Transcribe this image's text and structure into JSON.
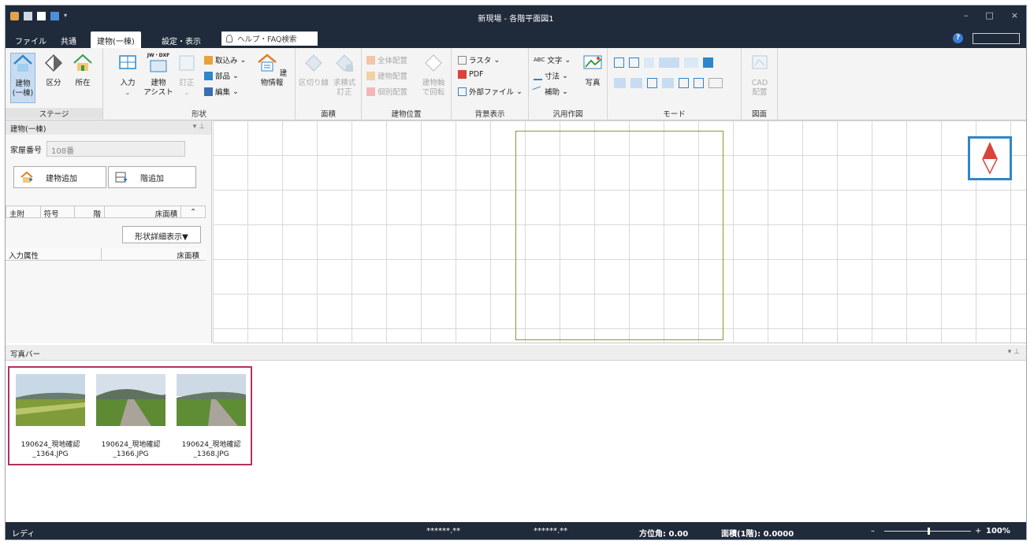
{
  "window": {
    "title": "新現場 - 各階平面図1",
    "min": "–",
    "max": "□",
    "close": "×"
  },
  "tabs": [
    {
      "label": "ファイル"
    },
    {
      "label": "共通"
    },
    {
      "label": "建物(一棟)"
    },
    {
      "label": "設定・表示"
    }
  ],
  "help": {
    "placeholder": "ヘルプ・FAQ検索",
    "help_icon": "?"
  },
  "ribbon": {
    "stage": {
      "label": "ステージ",
      "b1": "建物\n(一棟)",
      "b2": "区分",
      "b3": "所在"
    },
    "shape": {
      "label": "形状",
      "input": "入力",
      "assist": "建物\nアシスト",
      "fix": "訂正",
      "import": "取込み",
      "parts": "部品",
      "edit": "編集",
      "info": "建物情報",
      "jw": "JW・DXF"
    },
    "area": {
      "label": "面積",
      "divide": "区切り線",
      "calc": "求積式\n訂正"
    },
    "pos": {
      "label": "建物位置",
      "all": "全体配置",
      "place": "建物配置",
      "each": "個別配置",
      "rotate": "建物軸\nで回転"
    },
    "bg": {
      "label": "背景表示",
      "raster": "ラスタ",
      "pdf": "PDF",
      "external": "外部ファイル"
    },
    "draw": {
      "label": "汎用作図",
      "text": "文字",
      "dim": "寸法",
      "aux": "補助",
      "photo": "写真",
      "abc": "ABC"
    },
    "mode": {
      "label": "モード"
    },
    "fig": {
      "label": "図面",
      "cad": "CAD\n配置"
    }
  },
  "panel": {
    "title": "建物(一棟)",
    "house_no_label": "家屋番号",
    "house_no_value": "108番",
    "add_building": "建物追加",
    "add_floor": "階追加",
    "cols": [
      "主附",
      "符号",
      "階",
      "床面積"
    ],
    "detail_button": "形状詳細表示▼",
    "attr_cols": [
      "入力属性",
      "床面積"
    ]
  },
  "photobar": {
    "title": "写真バー",
    "photos": [
      {
        "name": "190624_現地確認\n_1364.JPG"
      },
      {
        "name": "190624_現地確認\n_1366.JPG"
      },
      {
        "name": "190624_現地確認\n_1368.JPG"
      }
    ]
  },
  "status": {
    "ready": "レディ",
    "x": "******.**",
    "y": "******.**",
    "azimuth": "方位角: 0.00",
    "area": "面積(1階): 0.0000",
    "zoom_minus": "–",
    "zoom_plus": "+",
    "zoom": "100%"
  },
  "colors": {
    "titlebar": "#1f2a3a",
    "plot_border": "#8a9a2a",
    "compass_border": "#2f86c8",
    "photo_highlight": "#b0325f"
  }
}
